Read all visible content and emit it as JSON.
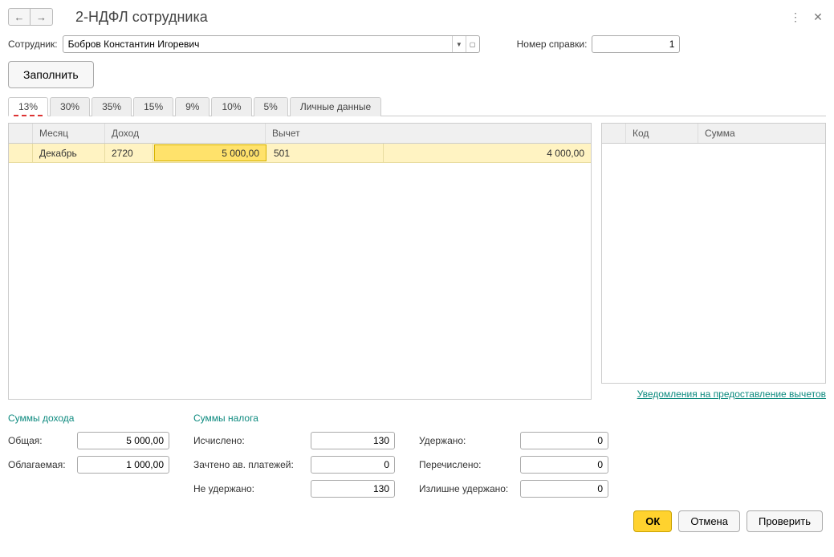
{
  "title": "2-НДФЛ сотрудника",
  "employee_label": "Сотрудник:",
  "employee_value": "Бобров Константин Игоревич",
  "ref_number_label": "Номер справки:",
  "ref_number_value": "1",
  "fill_button": "Заполнить",
  "tabs": [
    "13%",
    "30%",
    "35%",
    "15%",
    "9%",
    "10%",
    "5%",
    "Личные данные"
  ],
  "grid": {
    "headers": {
      "month": "Месяц",
      "income": "Доход",
      "deduction": "Вычет"
    },
    "row": {
      "month": "Декабрь",
      "income_code": "2720",
      "income_amt": "5 000,00",
      "deduct_code": "501",
      "deduct_amt": "4 000,00"
    }
  },
  "side_grid": {
    "headers": {
      "code": "Код",
      "sum": "Сумма"
    }
  },
  "link": "Уведомления на предоставление вычетов",
  "income_sums": {
    "title": "Суммы дохода",
    "total_label": "Общая:",
    "total_value": "5 000,00",
    "taxable_label": "Облагаемая:",
    "taxable_value": "1 000,00"
  },
  "tax_sums": {
    "title": "Суммы налога",
    "calculated_label": "Исчислено:",
    "calculated_value": "130",
    "advance_label": "Зачтено ав. платежей:",
    "advance_value": "0",
    "not_withheld_label": "Не удержано:",
    "not_withheld_value": "130",
    "withheld_label": "Удержано:",
    "withheld_value": "0",
    "transferred_label": "Перечислено:",
    "transferred_value": "0",
    "excess_label": "Излишне удержано:",
    "excess_value": "0"
  },
  "footer": {
    "ok": "ОК",
    "cancel": "Отмена",
    "check": "Проверить"
  }
}
